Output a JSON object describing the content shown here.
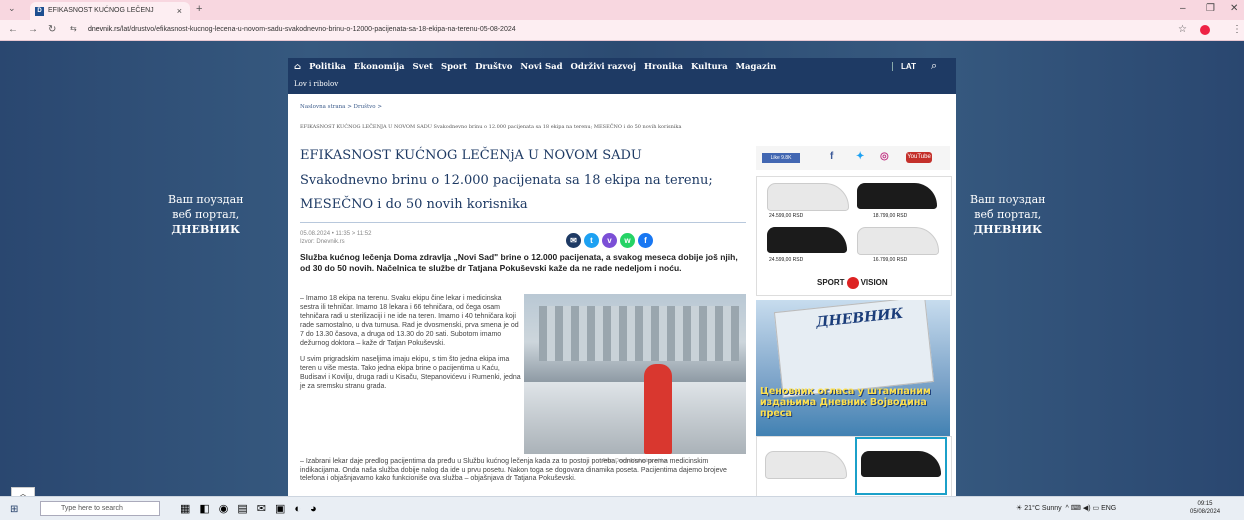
{
  "browser": {
    "tab_title": "EFIKASNOST KUĆNOG LEČENJ",
    "tab_favicon": "D",
    "url_host": "dnevnik.rs",
    "url_path": "/lat/drustvo/efikasnost-kucnog-lecena-u-novom-sadu-svakodnevno-brinu-o-12000-pacijenata-sa-18-ekipa-na-terenu-05-08-2024"
  },
  "side_banner": {
    "line1": "Ваш поуздан",
    "line2": "веб портал,",
    "line3": "ДНЕВНИК"
  },
  "site_nav": {
    "items": [
      "Politika",
      "Ekonomija",
      "Svet",
      "Sport",
      "Društvo",
      "Novi Sad",
      "Održivi razvoj",
      "Hronika",
      "Kultura",
      "Magazin"
    ],
    "sub": "Lov i ribolov",
    "lat": "LAT"
  },
  "breadcrumb": {
    "home": "Naslovna strana",
    "sep": ">",
    "section": "Društvo",
    "trail": "EFIKASNOST KUĆNOG LEČENJA U NOVOM SADU Svakodnevno brinu o 12.000 pacijenata sa 18 ekipa na terenu; MESEČNO i do 50 novih korisnika"
  },
  "article": {
    "kicker": "EFIKASNOST KUĆNOG LEČENjA U NOVOM SADU",
    "title": "Svakodnevno brinu o 12.000 pacijenata sa 18 ekipa na terenu; MESEČNO i do 50 novih korisnika",
    "date": "05.08.2024 • 11:35 > 11:52",
    "source": "Izvor: Dnevnik.rs",
    "lead": "Služba kućnog lečenja Doma zdravlja „Novi Sad\" brine o 12.000 pacijenata, a svakog meseca dobije još njih, od 30 do 50 novih. Načelnica te službe dr Tatjana Pokuševski kaže da ne rade nedeljom i noću.",
    "p1": "– Imamo 18 ekipa na terenu. Svaku ekipu čine lekar i medicinska sestra ili tehničar. Imamo 18 lekara i 66 tehničara, od čega osam tehničara radi u sterilizaciji i ne ide na teren. Imamo i 40 tehničara koji rade samostalno, u dva turnusa. Rad je dvosmenski, prva smena je od 7 do 13.30 časova, a druga od 13.30 do 20 sati. Subotom imamo dežurnog doktora – kaže dr Tatjan Pokuševski.",
    "p2": "U svim prigradskim naseljima imaju ekipu, s tim što jedna ekipa ima teren u više mesta. Tako jedna ekipa brine o pacijentima u Kaću, Budisavi i Kovilju, druga radi u Kisaču, Stepanovićevu i Rumenki, jedna je za sremsku stranu grada.",
    "p3": "– Izabrani lekar daje predlog pacijentima da pređu u Službu kućnog lečenja kada za to postoji potreba, odnosno prema medicinskim indikacijama. Onda naša služba dobije nalog da ide u prvu posetu. Nakon toga se dogovara dinamika poseta. Pacijentima dajemo brojeve telefona i objašnjavamo kako funkcioniše ova služba – objašnjava dr Tatjana Pokuševski.",
    "photo_caption": "Foto: Dnevnik/privatna arhiva"
  },
  "social": {
    "like": "Like 9.8K",
    "youtube": "YouTube"
  },
  "ad": {
    "prices": [
      "24.599,00 RSD",
      "18.799,00 RSD",
      "24.599,00 RSD",
      "16.799,00 RSD"
    ],
    "brand_left": "SPORT",
    "brand_right": "VISION"
  },
  "magazine": {
    "masthead": "ДНЕВНИК",
    "text": "Ценовник огласа у штампаним издањима Дневник Војводина преса"
  },
  "taskbar": {
    "search_placeholder": "Type here to search",
    "weather": "21°C Sunny",
    "lang": "ENG",
    "time": "09:15",
    "date": "05/08/2024"
  }
}
